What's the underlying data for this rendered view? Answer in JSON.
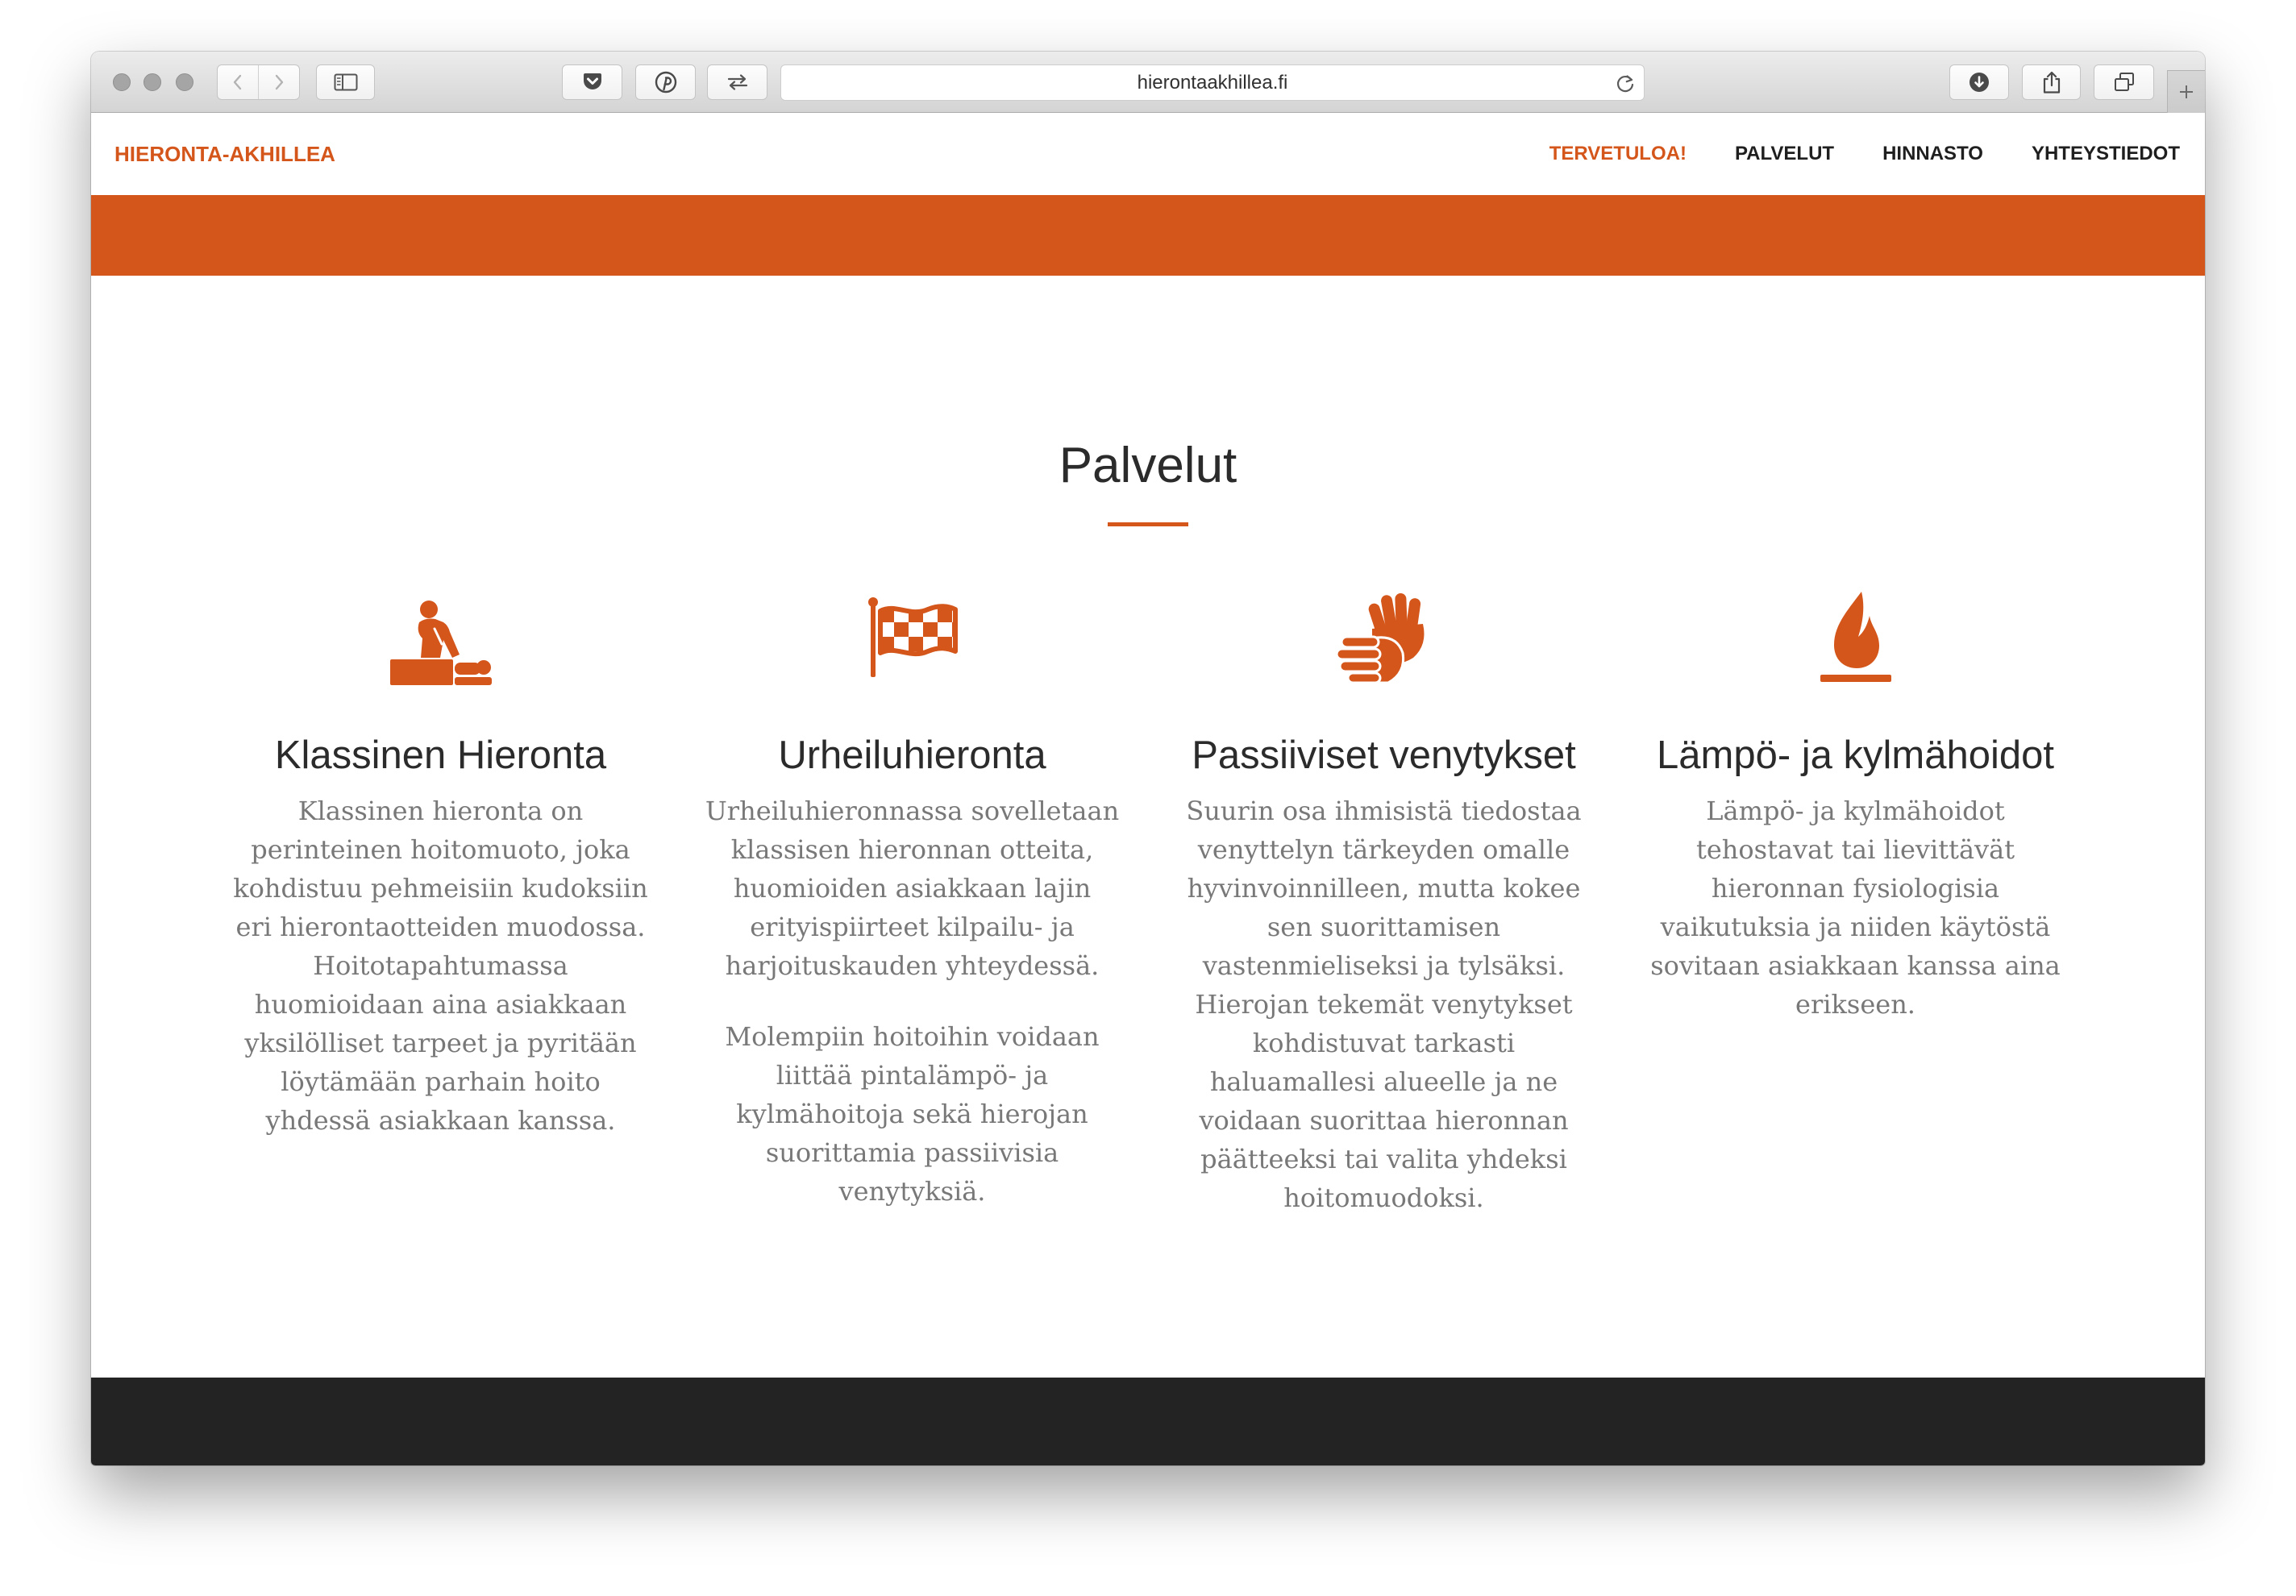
{
  "browser": {
    "url": "hierontaakhillea.fi",
    "toolbar_icons": [
      "back-icon",
      "forward-icon",
      "sidebar-icon",
      "pocket-icon",
      "pinterest-icon",
      "swap-arrows-icon",
      "reload-icon",
      "download-icon",
      "share-icon",
      "tabs-icon",
      "plus-icon"
    ]
  },
  "site": {
    "logo": "HIERONTA-AKHILLEA",
    "nav": [
      {
        "label": "TERVETULOA!",
        "active": true
      },
      {
        "label": "PALVELUT",
        "active": false
      },
      {
        "label": "HINNASTO",
        "active": false
      },
      {
        "label": "YHTEYSTIEDOT",
        "active": false
      }
    ]
  },
  "services": {
    "title": "Palvelut",
    "items": [
      {
        "icon": "massage-icon",
        "title": "Klassinen Hieronta",
        "paragraphs": [
          [
            "Klassinen hieronta on",
            "perinteinen hoitomuoto, joka",
            "kohdistuu pehmeisiin kudoksiin",
            "eri hierontaotteiden muodossa.",
            "Hoitotapahtumassa",
            "huomioidaan aina asiakkaan",
            "yksilölliset tarpeet ja pyritään",
            "löytämään parhain hoito",
            "yhdessä asiakkaan kanssa."
          ]
        ]
      },
      {
        "icon": "checkered-flag-icon",
        "title": "Urheiluhieronta",
        "paragraphs": [
          [
            "Urheiluhieronnassa sovelletaan",
            "klassisen hieronnan otteita,",
            "huomioiden asiakkaan lajin",
            "erityispiirteet kilpailu- ja",
            "harjoituskauden yhteydessä."
          ],
          [
            "Molempiin hoitoihin voidaan",
            "liittää pintalämpö- ja",
            "kylmähoitoja sekä hierojan",
            "suorittamia passiivisia",
            "venytyksiä."
          ]
        ]
      },
      {
        "icon": "hands-icon",
        "title": "Passiiviset venytykset",
        "paragraphs": [
          [
            "Suurin osa ihmisistä tiedostaa",
            "venyttelyn tärkeyden omalle",
            "hyvinvoinnilleen, mutta kokee",
            "sen suorittamisen",
            "vastenmieliseksi ja tylsäksi.",
            "Hierojan tekemät venytykset",
            "kohdistuvat tarkasti",
            "haluamallesi alueelle ja ne",
            "voidaan suorittaa hieronnan",
            "päätteeksi tai valita yhdeksi",
            "hoitomuodoksi."
          ]
        ]
      },
      {
        "icon": "flame-icon",
        "title": "Lämpö- ja kylmähoidot",
        "paragraphs": [
          [
            "Lämpö- ja kylmähoidot",
            "tehostavat tai lievittävät",
            "hieronnan fysiologisia",
            "vaikutuksia ja niiden käytöstä",
            "sovitaan asiakkaan kanssa aina",
            "erikseen."
          ]
        ]
      }
    ]
  },
  "colors": {
    "accent": "#d4561b",
    "heading": "#2b2b2b",
    "body_text": "#787878",
    "footer": "#232323",
    "toolbar": "#dedede"
  }
}
